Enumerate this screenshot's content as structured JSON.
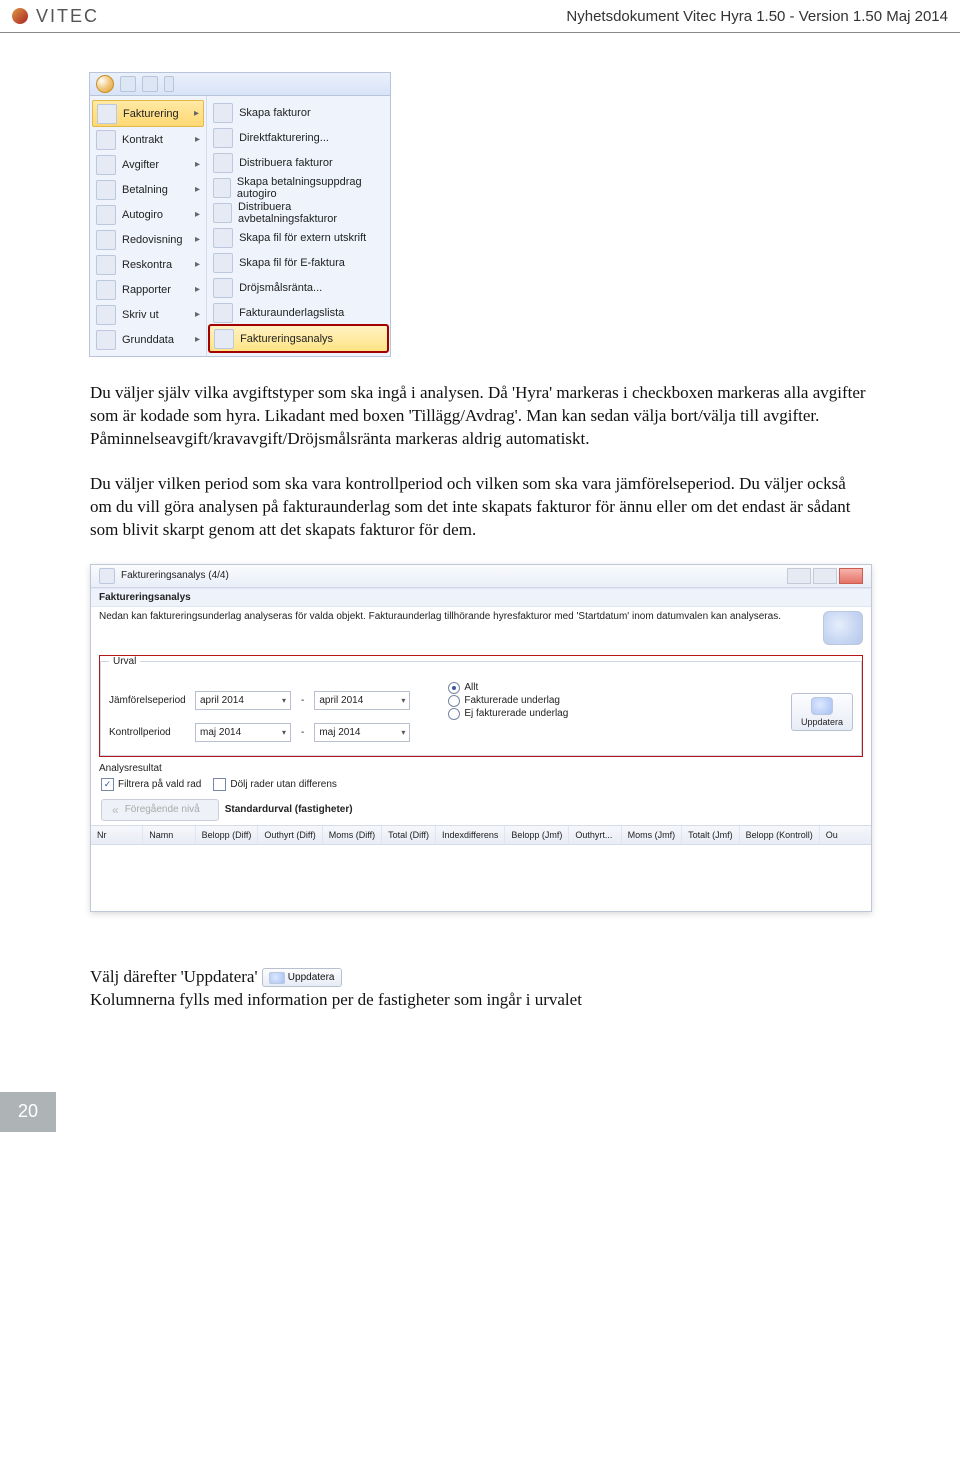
{
  "header": {
    "brand": "VITEC",
    "doc_title": "Nyhetsdokument Vitec Hyra 1.50 - Version 1.50 Maj 2014"
  },
  "menu": {
    "left": [
      {
        "label": "Fakturering",
        "state": "active"
      },
      {
        "label": "Kontrakt"
      },
      {
        "label": "Avgifter"
      },
      {
        "label": "Betalning"
      },
      {
        "label": "Autogiro"
      },
      {
        "label": "Redovisning"
      },
      {
        "label": "Reskontra"
      },
      {
        "label": "Rapporter"
      },
      {
        "label": "Skriv ut"
      },
      {
        "label": "Grunddata"
      }
    ],
    "right": [
      {
        "label": "Skapa fakturor"
      },
      {
        "label": "Direktfakturering..."
      },
      {
        "label": "Distribuera fakturor"
      },
      {
        "label": "Skapa betalningsuppdrag autogiro"
      },
      {
        "label": "Distribuera avbetalningsfakturor"
      },
      {
        "label": "Skapa fil för extern utskrift"
      },
      {
        "label": "Skapa fil för E-faktura"
      },
      {
        "label": "Dröjsmålsränta..."
      },
      {
        "label": "Fakturaunderlagslista"
      },
      {
        "label": "Faktureringsanalys",
        "state": "highlight-red"
      }
    ]
  },
  "para1": "Du väljer själv vilka avgiftstyper som ska ingå i analysen. Då 'Hyra' markeras i checkboxen markeras alla avgifter som är kodade som hyra. Likadant med boxen 'Tillägg/Avdrag'. Man kan sedan välja bort/välja till avgifter. Påminnelseavgift/kravavgift/Dröjsmålsränta markeras aldrig automatiskt.",
  "para2": "Du väljer vilken period som ska vara kontrollperiod och vilken som ska vara jämförelseperiod. Du väljer också om du vill göra analysen på fakturaunderlag som det inte skapats fakturor för ännu eller om det endast är sådant som blivit skarpt genom att det skapats fakturor för dem.",
  "dlg": {
    "title": "Faktureringsanalys (4/4)",
    "section_header": "Faktureringsanalys",
    "help_text": "Nedan kan faktureringsunderlag analyseras för valda objekt. Fakturaunderlag tillhörande hyresfakturor med 'Startdatum' inom datumvalen kan analyseras.",
    "urval_label": "Urval",
    "jfr_label": "Jämförelseperiod",
    "ktr_label": "Kontrollperiod",
    "jfr_from": "april 2014",
    "jfr_to": "april 2014",
    "ktr_from": "maj 2014",
    "ktr_to": "maj 2014",
    "radio_all": "Allt",
    "radio_fakturerade": "Fakturerade underlag",
    "radio_ej": "Ej fakturerade underlag",
    "uppdatera": "Uppdatera",
    "analys_header": "Analysresultat",
    "cb_filtrera": "Filtrera på vald rad",
    "cb_dolj": "Dölj rader utan differens",
    "prev_btn": "Föregående nivå",
    "std_sel": "Standardurval (fastigheter)",
    "cols": [
      "Nr",
      "Namn",
      "Belopp (Diff)",
      "Outhyrt (Diff)",
      "Moms (Diff)",
      "Total (Diff)",
      "Indexdifferens",
      "Belopp (Jmf)",
      "Outhyrt...",
      "Moms (Jmf)",
      "Totalt (Jmf)",
      "Belopp (Kontroll)",
      "Ou"
    ]
  },
  "para3_lead": "Välj därefter 'Uppdatera' ",
  "para3_btn": "Uppdatera",
  "para3_rest": "Kolumnerna fylls med information per de fastigheter som ingår i urvalet",
  "page_number": "20"
}
